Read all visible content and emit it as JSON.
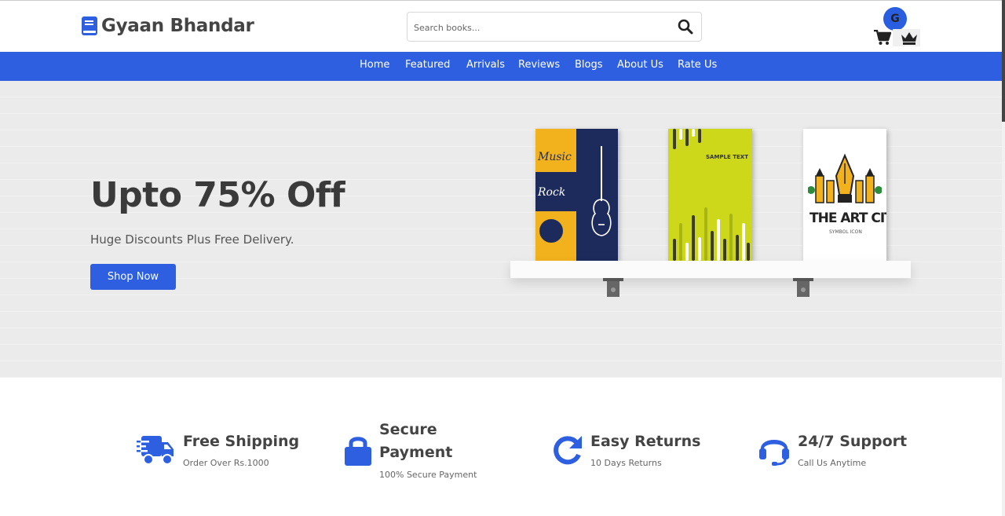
{
  "brand": {
    "name": "Gyaan Bhandar"
  },
  "search": {
    "placeholder": "Search books..."
  },
  "user": {
    "initial": "G"
  },
  "nav": {
    "items": [
      "Home",
      "Featured",
      "Arrivals",
      "Reviews",
      "Blogs",
      "About Us",
      "Rate Us"
    ]
  },
  "hero": {
    "headline": "Upto 75% Off",
    "subtext": "Huge Discounts Plus Free Delivery.",
    "cta": "Shop Now",
    "book1": {
      "text1": "Music",
      "text2": "Rock"
    },
    "book2": {
      "text": "SAMPLE TEXT"
    },
    "book3": {
      "title": "THE ART CITY",
      "subtitle": "SYMBOL ICON"
    }
  },
  "features": [
    {
      "title": "Free Shipping",
      "subtitle": "Order Over Rs.1000",
      "icon": "truck-icon"
    },
    {
      "title": "Secure Payment",
      "title_line1": "Secure",
      "title_line2": "Payment",
      "subtitle": "100% Secure Payment",
      "icon": "lock-icon"
    },
    {
      "title": "Easy Returns",
      "subtitle": "10 Days Returns",
      "icon": "redo-icon"
    },
    {
      "title": "24/7 Support",
      "subtitle": "Call Us Anytime",
      "icon": "headset-icon"
    }
  ],
  "colors": {
    "accent": "#2d5fe0",
    "text": "#444444",
    "hero_bg": "#ebebeb"
  }
}
